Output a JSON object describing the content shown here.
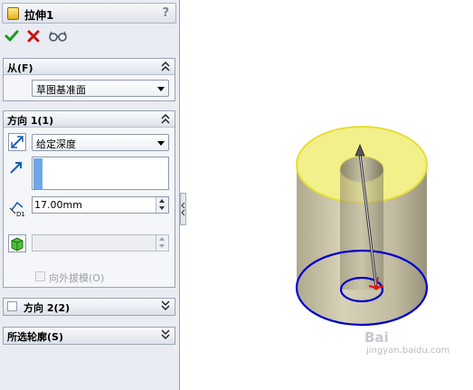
{
  "property_manager": {
    "title": "拉伸1",
    "help_label": "?",
    "feature_icon": "extrude-feature-icon",
    "actions": {
      "ok_icon": "checkmark-icon",
      "cancel_icon": "x-icon",
      "preview_icon": "glasses-icon"
    }
  },
  "from_group": {
    "title": "从(F)",
    "start_condition": "草图基准面"
  },
  "direction1_group": {
    "title": "方向 1(1)",
    "end_condition": "给定深度",
    "depth_value": "17.00mm",
    "depth_symbol": "D1",
    "draft_value": "",
    "draft_outward_label": "向外拔模(O)"
  },
  "direction2_group": {
    "title": "方向 2(2)"
  },
  "selected_contours_group": {
    "title": "所选轮廓(S)"
  },
  "watermark": {
    "logo": "Bai",
    "text": "jingyan.baidu.com"
  },
  "colors": {
    "top_face_fill": "#f2f08a",
    "top_face_edge": "#e5dd35",
    "body_fill": "#bdb59a",
    "sketch_circle": "#0000cc",
    "panel_bg": "#e9ecf2"
  }
}
